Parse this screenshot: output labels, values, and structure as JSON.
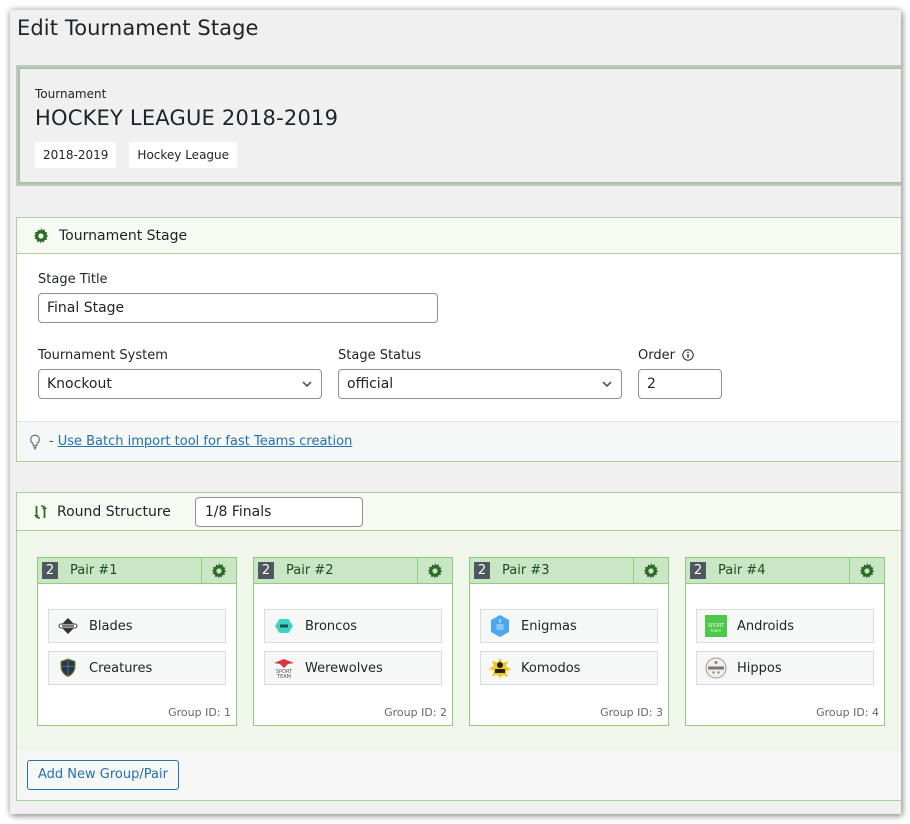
{
  "page": {
    "title": "Edit Tournament Stage"
  },
  "tournament": {
    "label": "Tournament",
    "name": "HOCKEY LEAGUE 2018-2019",
    "tags": [
      "2018-2019",
      "Hockey League"
    ]
  },
  "stage": {
    "header": "Tournament Stage",
    "stage_title_label": "Stage Title",
    "stage_title_value": "Final Stage",
    "system_label": "Tournament System",
    "system_value": "Knockout",
    "status_label": "Stage Status",
    "status_value": "official",
    "order_label": "Order",
    "order_value": "2",
    "tip_prefix": "-",
    "tip_link": "Use Batch import tool for fast Teams creation"
  },
  "round": {
    "header": "Round Structure",
    "value": "1/8 Finals",
    "add_button": "Add New Group/Pair",
    "pairs": [
      {
        "round_num": "2",
        "title": "Pair #1",
        "teams": [
          "Blades",
          "Creatures"
        ],
        "group_id": "Group ID: 1"
      },
      {
        "round_num": "2",
        "title": "Pair #2",
        "teams": [
          "Broncos",
          "Werewolves"
        ],
        "group_id": "Group ID: 2"
      },
      {
        "round_num": "2",
        "title": "Pair #3",
        "teams": [
          "Enigmas",
          "Komodos"
        ],
        "group_id": "Group ID: 3"
      },
      {
        "round_num": "2",
        "title": "Pair #4",
        "teams": [
          "Androids",
          "Hippos"
        ],
        "group_id": "Group ID: 4"
      }
    ]
  },
  "colors": {
    "accent_green": "#2e6b25",
    "link_blue": "#2271b1",
    "border_green": "#a7d19d",
    "pair_head": "#c9e6c5"
  }
}
